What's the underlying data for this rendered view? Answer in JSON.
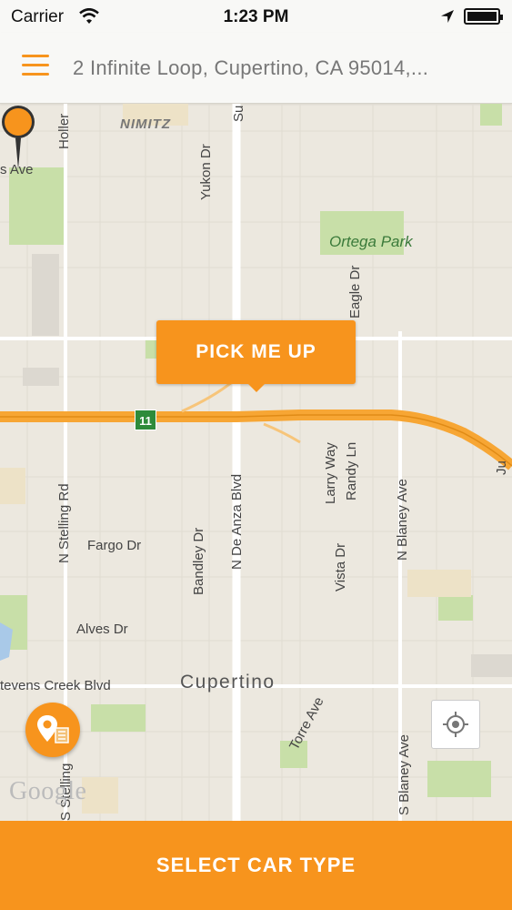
{
  "status_bar": {
    "carrier": "Carrier",
    "time": "1:23 PM"
  },
  "header": {
    "address": "2 Infinite Loop, Cupertino, CA 95014,..."
  },
  "map": {
    "labels": {
      "nimitz": "NIMITZ",
      "s_ave": "s Ave",
      "holler": "Holler",
      "su": "Su",
      "yukon": "Yukon Dr",
      "ortega_park": "Ortega Park",
      "eagle": "Eagle Dr",
      "stelling_n": "N Stelling Rd",
      "fargo": "Fargo Dr",
      "bandley": "Bandley Dr",
      "de_anza": "N De Anza Blvd",
      "larry": "Larry Way",
      "randy": "Randy Ln",
      "vista": "Vista Dr",
      "blaney_n": "N Blaney Ave",
      "ju": "Ju",
      "alves": "Alves Dr",
      "stevens_creek": "tevens Creek Blvd",
      "cupertino": "Cupertino",
      "torre": "Torre Ave",
      "blaney_s": "S Blaney Ave",
      "stelling_s": "S Stelling"
    },
    "highway_shield": "11",
    "google": "Google"
  },
  "pickup_bubble": {
    "label": "PICK ME UP"
  },
  "bottom_button": {
    "label": "SELECT CAR TYPE"
  },
  "colors": {
    "accent": "#f7941d",
    "map_bg": "#ece8df",
    "park": "#c8dfa8",
    "road": "#ffffff",
    "highway": "#f7a634"
  }
}
